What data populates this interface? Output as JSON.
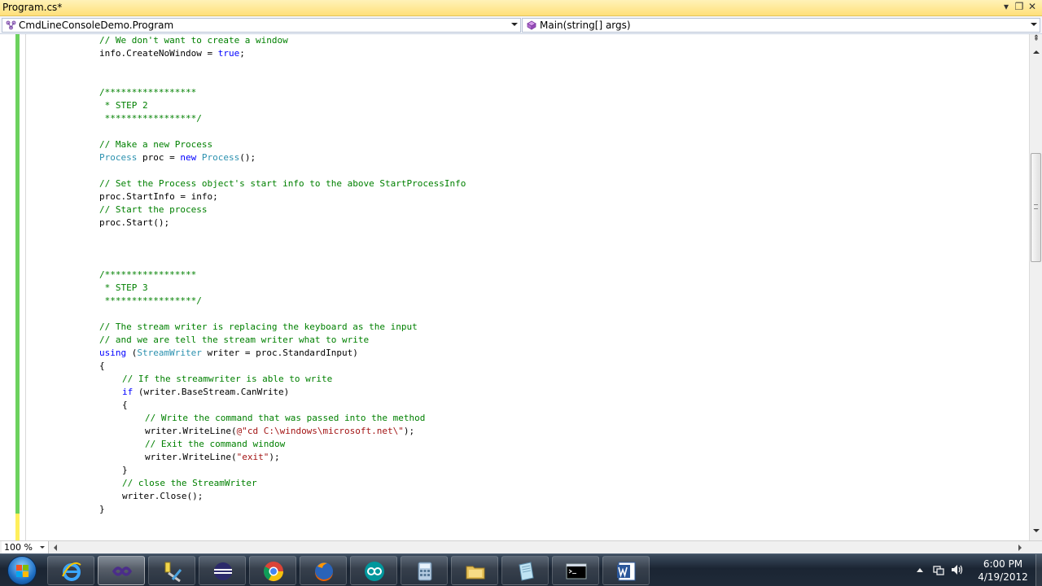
{
  "document_tab": {
    "title": "Program.cs*"
  },
  "window_buttons": {
    "dropdown": "▾",
    "restore": "❐",
    "close": "✕"
  },
  "navigation": {
    "class_combo": {
      "value": "CmdLineConsoleDemo.Program",
      "icon": "class-icon"
    },
    "member_combo": {
      "value": "Main(string[] args)",
      "icon": "method-icon"
    }
  },
  "code": {
    "lines": [
      {
        "indent": 0,
        "tokens": [
          {
            "t": "comment",
            "s": "// We don't want to create a window"
          }
        ]
      },
      {
        "indent": 0,
        "tokens": [
          {
            "t": "plain",
            "s": "info.CreateNoWindow = "
          },
          {
            "t": "keyword",
            "s": "true"
          },
          {
            "t": "plain",
            "s": ";"
          }
        ]
      },
      {
        "indent": 0,
        "tokens": [
          {
            "t": "comment",
            "s": "/*****************"
          }
        ]
      },
      {
        "indent": 0,
        "tokens": [
          {
            "t": "comment",
            "s": " * STEP 2"
          }
        ]
      },
      {
        "indent": 0,
        "tokens": [
          {
            "t": "comment",
            "s": " *****************/"
          }
        ]
      },
      {
        "indent": 0,
        "tokens": [
          {
            "t": "comment",
            "s": "// Make a new Process"
          }
        ]
      },
      {
        "indent": 0,
        "tokens": [
          {
            "t": "type",
            "s": "Process"
          },
          {
            "t": "plain",
            "s": " proc = "
          },
          {
            "t": "keyword",
            "s": "new"
          },
          {
            "t": "plain",
            "s": " "
          },
          {
            "t": "type",
            "s": "Process"
          },
          {
            "t": "plain",
            "s": "();"
          }
        ]
      },
      {
        "indent": 0,
        "tokens": [
          {
            "t": "comment",
            "s": "// Set the Process object's start info to the above StartProcessInfo"
          }
        ]
      },
      {
        "indent": 0,
        "tokens": [
          {
            "t": "plain",
            "s": "proc.StartInfo = info;"
          }
        ]
      },
      {
        "indent": 0,
        "tokens": [
          {
            "t": "comment",
            "s": "// Start the process"
          }
        ]
      },
      {
        "indent": 0,
        "tokens": [
          {
            "t": "plain",
            "s": "proc.Start();"
          }
        ]
      },
      {
        "indent": 0,
        "tokens": [
          {
            "t": "comment",
            "s": "/*****************"
          }
        ]
      },
      {
        "indent": 0,
        "tokens": [
          {
            "t": "comment",
            "s": " * STEP 3"
          }
        ]
      },
      {
        "indent": 0,
        "tokens": [
          {
            "t": "comment",
            "s": " *****************/"
          }
        ]
      },
      {
        "indent": 0,
        "tokens": [
          {
            "t": "comment",
            "s": "// The stream writer is replacing the keyboard as the input"
          }
        ]
      },
      {
        "indent": 0,
        "tokens": [
          {
            "t": "comment",
            "s": "// and we are tell the stream writer what to write"
          }
        ]
      },
      {
        "indent": 0,
        "tokens": [
          {
            "t": "keyword",
            "s": "using"
          },
          {
            "t": "plain",
            "s": " ("
          },
          {
            "t": "type",
            "s": "StreamWriter"
          },
          {
            "t": "plain",
            "s": " writer = proc.StandardInput)"
          }
        ]
      },
      {
        "indent": 0,
        "tokens": [
          {
            "t": "plain",
            "s": "{"
          }
        ]
      },
      {
        "indent": 1,
        "tokens": [
          {
            "t": "comment",
            "s": "// If the streamwriter is able to write"
          }
        ]
      },
      {
        "indent": 1,
        "tokens": [
          {
            "t": "keyword",
            "s": "if"
          },
          {
            "t": "plain",
            "s": " (writer.BaseStream.CanWrite)"
          }
        ]
      },
      {
        "indent": 1,
        "tokens": [
          {
            "t": "plain",
            "s": "{"
          }
        ]
      },
      {
        "indent": 2,
        "tokens": [
          {
            "t": "comment",
            "s": "// Write the command that was passed into the method"
          }
        ]
      },
      {
        "indent": 2,
        "tokens": [
          {
            "t": "plain",
            "s": "writer.WriteLine("
          },
          {
            "t": "string",
            "s": "@\"cd C:\\windows\\microsoft.net\\\""
          },
          {
            "t": "plain",
            "s": ");"
          }
        ]
      },
      {
        "indent": 2,
        "tokens": [
          {
            "t": "comment",
            "s": "// Exit the command window"
          }
        ]
      },
      {
        "indent": 2,
        "tokens": [
          {
            "t": "plain",
            "s": "writer.WriteLine("
          },
          {
            "t": "string",
            "s": "\"exit\""
          },
          {
            "t": "plain",
            "s": ");"
          }
        ]
      },
      {
        "indent": 1,
        "tokens": [
          {
            "t": "plain",
            "s": "}"
          }
        ]
      },
      {
        "indent": 1,
        "tokens": [
          {
            "t": "comment",
            "s": "// close the StreamWriter"
          }
        ]
      },
      {
        "indent": 1,
        "tokens": [
          {
            "t": "plain",
            "s": "writer.Close();"
          }
        ]
      },
      {
        "indent": 0,
        "tokens": [
          {
            "t": "plain",
            "s": "}"
          }
        ]
      }
    ]
  },
  "zoom": {
    "value": "100 %"
  },
  "taskbar": {
    "apps": [
      {
        "name": "internet-explorer-icon",
        "active": false
      },
      {
        "name": "visual-studio-icon",
        "active": true
      },
      {
        "name": "tools-icon",
        "active": false
      },
      {
        "name": "eclipse-icon",
        "active": false
      },
      {
        "name": "chrome-icon",
        "active": false
      },
      {
        "name": "firefox-icon",
        "active": false
      },
      {
        "name": "arduino-icon",
        "active": false
      },
      {
        "name": "calculator-icon",
        "active": false
      },
      {
        "name": "file-explorer-icon",
        "active": false
      },
      {
        "name": "notepad-icon",
        "active": false
      },
      {
        "name": "command-prompt-icon",
        "active": false
      },
      {
        "name": "word-icon",
        "active": false
      }
    ],
    "clock": {
      "time": "6:00 PM",
      "date": "4/19/2012"
    }
  },
  "colors": {
    "comment": "#008000",
    "keyword": "#0000ff",
    "type": "#2b91af",
    "string": "#a31515",
    "tab_strip": "#ffe07a",
    "change_saved": "#6cd25e",
    "change_unsaved": "#ffef5b"
  }
}
